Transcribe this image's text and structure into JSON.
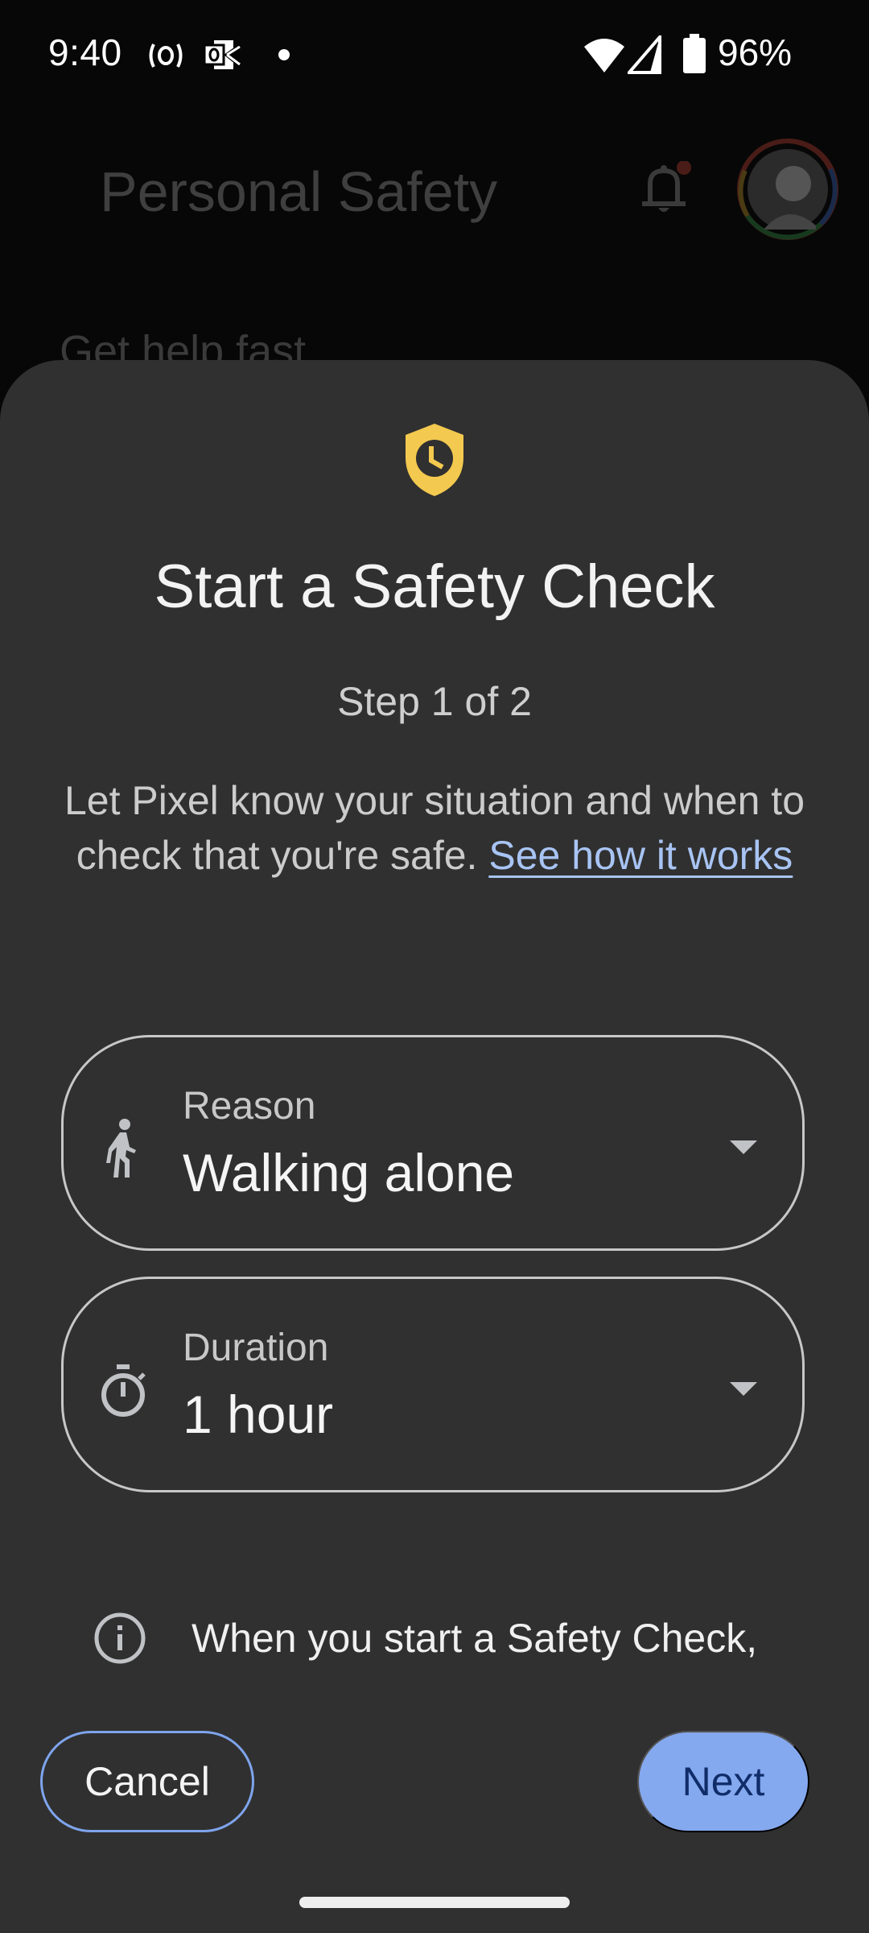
{
  "status_bar": {
    "time": "9:40",
    "icons_left": [
      "hotspot-icon",
      "outlook-icon",
      "notification-dot-icon"
    ],
    "icons_right": [
      "wifi-icon",
      "cell-signal-icon",
      "battery-icon"
    ],
    "battery_percent": "96%"
  },
  "background_app": {
    "title": "Personal Safety",
    "section_heading": "Get help fast",
    "notification_badge_color": "#7a2a22"
  },
  "sheet": {
    "icon": "shield-clock-icon",
    "icon_color": "#f4c94f",
    "title": "Start a Safety Check",
    "step": "Step 1 of 2",
    "description": "Let Pixel know your situation and when to check that you're safe.",
    "link_text": "See how it works",
    "fields": {
      "reason": {
        "label": "Reason",
        "value": "Walking alone",
        "icon": "walking-person-icon"
      },
      "duration": {
        "label": "Duration",
        "value": "1 hour",
        "icon": "stopwatch-icon"
      }
    },
    "info_text": "When you start a Safety Check, location sharing",
    "buttons": {
      "cancel": "Cancel",
      "next": "Next"
    },
    "accent_color": "#85a9ef"
  }
}
